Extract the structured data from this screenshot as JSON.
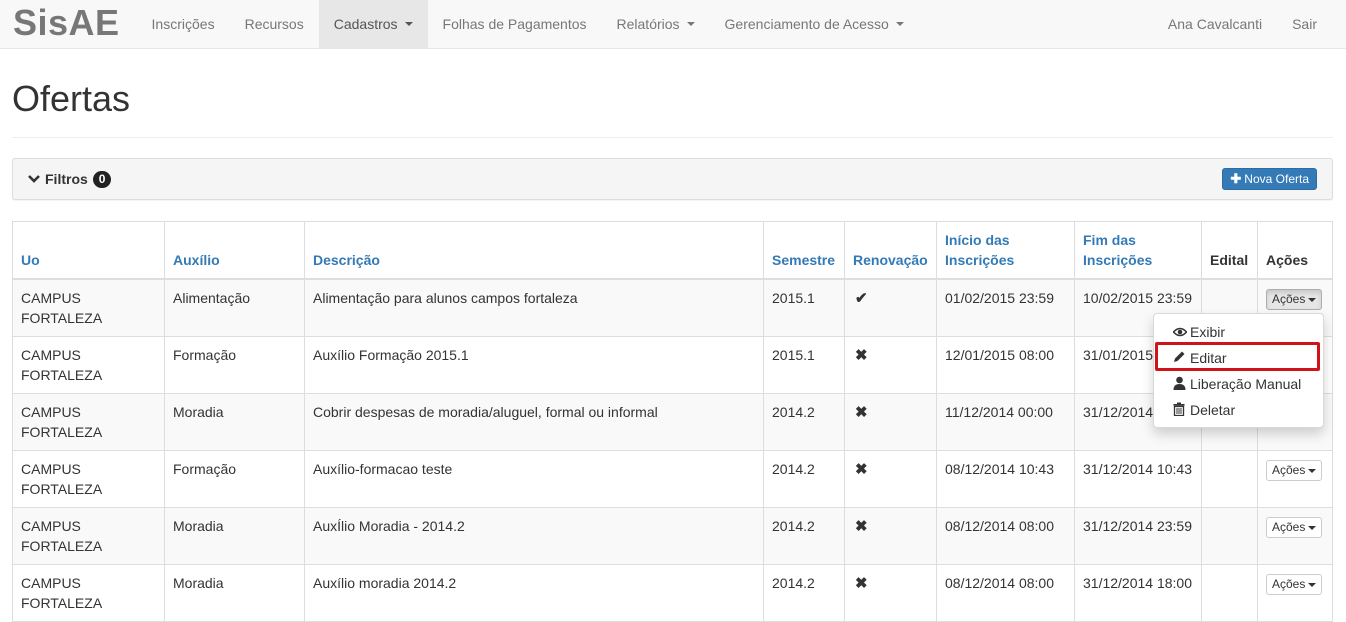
{
  "navbar": {
    "brand": "SisAE",
    "items": [
      {
        "label": "Inscrições"
      },
      {
        "label": "Recursos"
      },
      {
        "label": "Cadastros"
      },
      {
        "label": "Folhas de Pagamentos"
      },
      {
        "label": "Relatórios"
      },
      {
        "label": "Gerenciamento de Acesso"
      }
    ],
    "user": "Ana Cavalcanti",
    "logout": "Sair"
  },
  "page": {
    "title": "Ofertas"
  },
  "filter": {
    "label": "Filtros",
    "count": "0",
    "new_button": "Nova Oferta"
  },
  "table": {
    "headers": {
      "uo": "Uo",
      "auxilio": "Auxílio",
      "descricao": "Descrição",
      "semestre": "Semestre",
      "renovacao": "Renovação",
      "inicio": "Início das Inscrições",
      "fim": "Fim das Inscrições",
      "edital": "Edital",
      "acoes": "Ações"
    },
    "actions_label": "Ações",
    "rows": [
      {
        "uo": "CAMPUS FORTALEZA",
        "auxilio": "Alimentação",
        "descricao": "Alimentação para alunos campos fortaleza",
        "semestre": "2015.1",
        "renovacao": "✔",
        "inicio": "01/02/2015 23:59",
        "fim": "10/02/2015 23:59",
        "edital": ""
      },
      {
        "uo": "CAMPUS FORTALEZA",
        "auxilio": "Formação",
        "descricao": "Auxílio Formação 2015.1",
        "semestre": "2015.1",
        "renovacao": "✖",
        "inicio": "12/01/2015 08:00",
        "fim": "31/01/2015",
        "edital": ""
      },
      {
        "uo": "CAMPUS FORTALEZA",
        "auxilio": "Moradia",
        "descricao": "Cobrir despesas de moradia/aluguel, formal ou informal",
        "semestre": "2014.2",
        "renovacao": "✖",
        "inicio": "11/12/2014 00:00",
        "fim": "31/12/2014",
        "edital": ""
      },
      {
        "uo": "CAMPUS FORTALEZA",
        "auxilio": "Formação",
        "descricao": "Auxílio-formacao teste",
        "semestre": "2014.2",
        "renovacao": "✖",
        "inicio": "08/12/2014 10:43",
        "fim": "31/12/2014 10:43",
        "edital": ""
      },
      {
        "uo": "CAMPUS FORTALEZA",
        "auxilio": "Moradia",
        "descricao": "AuxÍlio Moradia - 2014.2",
        "semestre": "2014.2",
        "renovacao": "✖",
        "inicio": "08/12/2014 08:00",
        "fim": "31/12/2014 23:59",
        "edital": ""
      },
      {
        "uo": "CAMPUS FORTALEZA",
        "auxilio": "Moradia",
        "descricao": "Auxílio moradia 2014.2",
        "semestre": "2014.2",
        "renovacao": "✖",
        "inicio": "08/12/2014 08:00",
        "fim": "31/12/2014 18:00",
        "edital": ""
      }
    ]
  },
  "dropdown": {
    "items": [
      {
        "label": "Exibir",
        "icon": "eye-icon"
      },
      {
        "label": "Editar",
        "icon": "pencil-icon"
      },
      {
        "label": "Liberação Manual",
        "icon": "user-icon"
      },
      {
        "label": "Deletar",
        "icon": "trash-icon"
      }
    ]
  },
  "colors": {
    "link": "#337ab7",
    "highlight": "#d0121b",
    "navbar_bg": "#f8f8f8"
  }
}
